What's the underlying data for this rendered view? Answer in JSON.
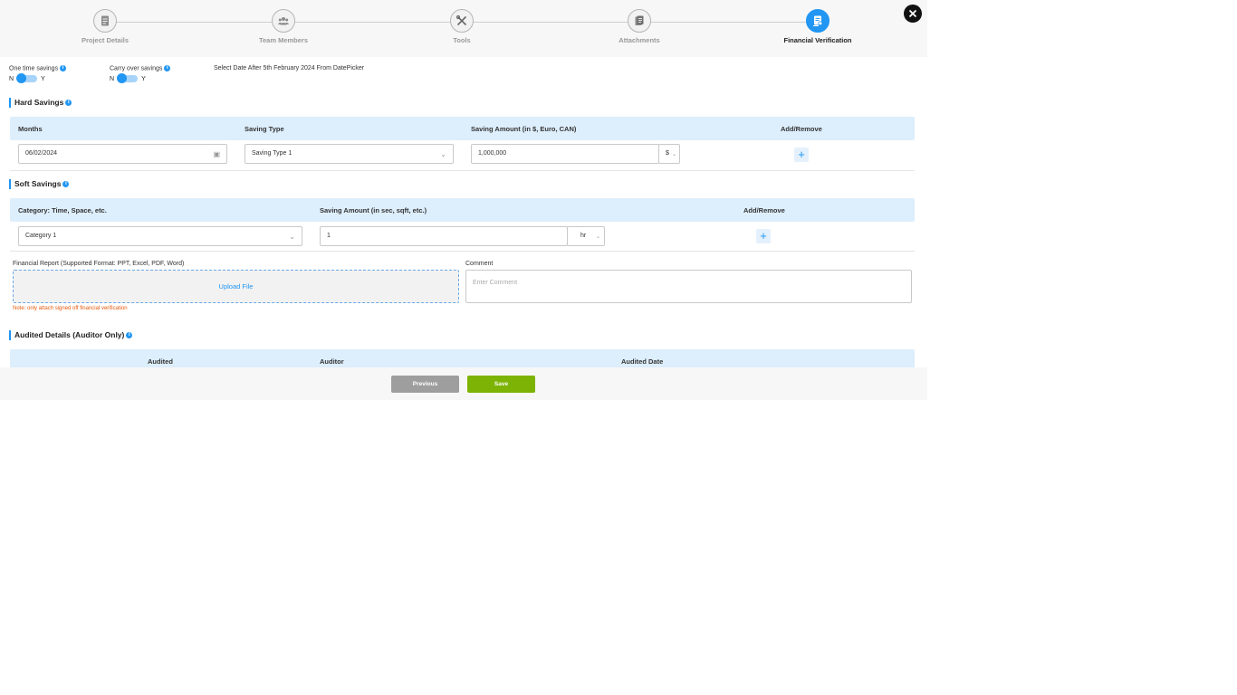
{
  "steps": [
    {
      "label": "Project Details",
      "icon": "document-icon"
    },
    {
      "label": "Team Members",
      "icon": "users-icon"
    },
    {
      "label": "Tools",
      "icon": "tools-icon"
    },
    {
      "label": "Attachments",
      "icon": "attachments-icon"
    },
    {
      "label": "Financial Verification",
      "icon": "verification-icon"
    }
  ],
  "active_step": "Financial Verification",
  "top": {
    "one_time_label": "One time savings",
    "carry_over_label": "Carry over savings",
    "toggle_n": "N",
    "toggle_y": "Y",
    "date_note": "Select Date After 5th February 2024 From DatePicker"
  },
  "hard": {
    "title": "Hard Savings",
    "headers": [
      "Months",
      "Saving Type",
      "Saving Amount (in $, Euro, CAN)",
      "Add/Remove"
    ],
    "month_value": "06/02/2024",
    "saving_type_value": "Saving Type 1",
    "amount_value": "1,000,000",
    "currency_value": "$"
  },
  "soft": {
    "title": "Soft Savings",
    "headers": [
      "Category: Time, Space, etc.",
      "Saving Amount (in sec, sqft, etc.)",
      "Add/Remove"
    ],
    "category_value": "Category 1",
    "amount_value": "1",
    "unit_value": "hr"
  },
  "report": {
    "label": "Financial Report (Supported Format: PPT, Excel, PDF, Word)",
    "upload_label": "Upload File",
    "note": "Note: only attach signed off financial verification",
    "comment_label": "Comment",
    "comment_placeholder": "Enter Comment"
  },
  "audited": {
    "title": "Audited Details (Auditor Only)",
    "headers": [
      "Audited",
      "Auditor",
      "Audited Date"
    ]
  },
  "footer": {
    "previous_label": "Previous",
    "save_label": "Save"
  },
  "colors": {
    "accent": "#2196f3",
    "save": "#7cb305",
    "previous": "#9e9e9e",
    "header_bg": "#ddeefc",
    "note": "#e8590c"
  }
}
